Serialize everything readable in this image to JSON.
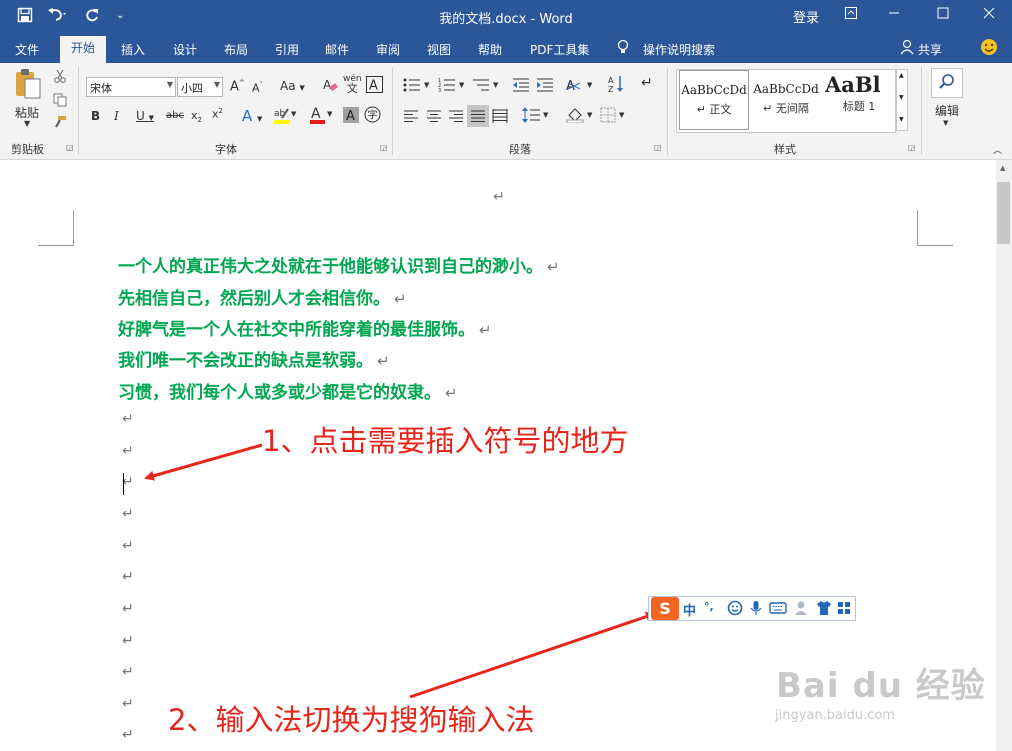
{
  "titlebar": {
    "title": "我的文档.docx  -  Word",
    "login": "登录",
    "icons": [
      "save-icon",
      "undo-icon",
      "redo-icon",
      "customize-icon",
      "ribbon-display-icon",
      "minimize-icon",
      "maximize-icon",
      "close-icon"
    ]
  },
  "tabs": [
    "文件",
    "开始",
    "插入",
    "设计",
    "布局",
    "引用",
    "邮件",
    "审阅",
    "视图",
    "帮助",
    "PDF工具集"
  ],
  "active_tab": "开始",
  "tell_me": "操作说明搜索",
  "share": "共享",
  "ribbon": {
    "clipboard": {
      "paste_label": "粘贴",
      "group_label": "剪贴板"
    },
    "font": {
      "font_name": "宋体",
      "font_size": "小四",
      "group_label": "字体",
      "wen_label": "wén\n文"
    },
    "paragraph": {
      "group_label": "段落"
    },
    "styles": {
      "group_label": "样式",
      "items": [
        {
          "sample": "AaBbCcDd",
          "name": "↵ 正文"
        },
        {
          "sample": "AaBbCcDd",
          "name": "↵ 无间隔"
        },
        {
          "sample": "AaBl",
          "name": "标题 1"
        }
      ]
    },
    "editing": {
      "label": "编辑"
    }
  },
  "document": {
    "lines": [
      "一个人的真正伟大之处就在于他能够认识到自己的渺小。",
      "先相信自己，然后别人才会相信你。",
      "好脾气是一个人在社交中所能穿着的最佳服饰。",
      "我们唯一不会改正的缺点是软弱。",
      "习惯，我们每个人或多或少都是它的奴隶。"
    ],
    "paragraph_mark": "↵",
    "text_color": "#00a651"
  },
  "annotations": {
    "step1": "1、点击需要插入符号的地方",
    "step2": "2、输入法切换为搜狗输入法",
    "color": "#e8251b"
  },
  "ime": {
    "logo": "S",
    "mode": "中",
    "punct": "°,",
    "icons": [
      "emoji-icon",
      "voice-icon",
      "keyboard-icon",
      "user-icon",
      "skin-icon",
      "toolbox-icon"
    ]
  },
  "watermark": {
    "logo": "Bai du 经验",
    "url": "jingyan.baidu.com"
  }
}
